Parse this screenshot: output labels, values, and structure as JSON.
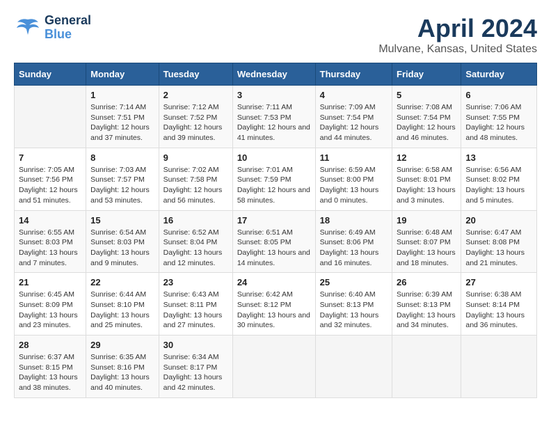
{
  "header": {
    "logo_general": "General",
    "logo_blue": "Blue",
    "month_title": "April 2024",
    "location": "Mulvane, Kansas, United States"
  },
  "calendar": {
    "weekdays": [
      "Sunday",
      "Monday",
      "Tuesday",
      "Wednesday",
      "Thursday",
      "Friday",
      "Saturday"
    ],
    "weeks": [
      [
        {
          "day": "",
          "sunrise": "",
          "sunset": "",
          "daylight": ""
        },
        {
          "day": "1",
          "sunrise": "Sunrise: 7:14 AM",
          "sunset": "Sunset: 7:51 PM",
          "daylight": "Daylight: 12 hours and 37 minutes."
        },
        {
          "day": "2",
          "sunrise": "Sunrise: 7:12 AM",
          "sunset": "Sunset: 7:52 PM",
          "daylight": "Daylight: 12 hours and 39 minutes."
        },
        {
          "day": "3",
          "sunrise": "Sunrise: 7:11 AM",
          "sunset": "Sunset: 7:53 PM",
          "daylight": "Daylight: 12 hours and 41 minutes."
        },
        {
          "day": "4",
          "sunrise": "Sunrise: 7:09 AM",
          "sunset": "Sunset: 7:54 PM",
          "daylight": "Daylight: 12 hours and 44 minutes."
        },
        {
          "day": "5",
          "sunrise": "Sunrise: 7:08 AM",
          "sunset": "Sunset: 7:54 PM",
          "daylight": "Daylight: 12 hours and 46 minutes."
        },
        {
          "day": "6",
          "sunrise": "Sunrise: 7:06 AM",
          "sunset": "Sunset: 7:55 PM",
          "daylight": "Daylight: 12 hours and 48 minutes."
        }
      ],
      [
        {
          "day": "7",
          "sunrise": "Sunrise: 7:05 AM",
          "sunset": "Sunset: 7:56 PM",
          "daylight": "Daylight: 12 hours and 51 minutes."
        },
        {
          "day": "8",
          "sunrise": "Sunrise: 7:03 AM",
          "sunset": "Sunset: 7:57 PM",
          "daylight": "Daylight: 12 hours and 53 minutes."
        },
        {
          "day": "9",
          "sunrise": "Sunrise: 7:02 AM",
          "sunset": "Sunset: 7:58 PM",
          "daylight": "Daylight: 12 hours and 56 minutes."
        },
        {
          "day": "10",
          "sunrise": "Sunrise: 7:01 AM",
          "sunset": "Sunset: 7:59 PM",
          "daylight": "Daylight: 12 hours and 58 minutes."
        },
        {
          "day": "11",
          "sunrise": "Sunrise: 6:59 AM",
          "sunset": "Sunset: 8:00 PM",
          "daylight": "Daylight: 13 hours and 0 minutes."
        },
        {
          "day": "12",
          "sunrise": "Sunrise: 6:58 AM",
          "sunset": "Sunset: 8:01 PM",
          "daylight": "Daylight: 13 hours and 3 minutes."
        },
        {
          "day": "13",
          "sunrise": "Sunrise: 6:56 AM",
          "sunset": "Sunset: 8:02 PM",
          "daylight": "Daylight: 13 hours and 5 minutes."
        }
      ],
      [
        {
          "day": "14",
          "sunrise": "Sunrise: 6:55 AM",
          "sunset": "Sunset: 8:03 PM",
          "daylight": "Daylight: 13 hours and 7 minutes."
        },
        {
          "day": "15",
          "sunrise": "Sunrise: 6:54 AM",
          "sunset": "Sunset: 8:03 PM",
          "daylight": "Daylight: 13 hours and 9 minutes."
        },
        {
          "day": "16",
          "sunrise": "Sunrise: 6:52 AM",
          "sunset": "Sunset: 8:04 PM",
          "daylight": "Daylight: 13 hours and 12 minutes."
        },
        {
          "day": "17",
          "sunrise": "Sunrise: 6:51 AM",
          "sunset": "Sunset: 8:05 PM",
          "daylight": "Daylight: 13 hours and 14 minutes."
        },
        {
          "day": "18",
          "sunrise": "Sunrise: 6:49 AM",
          "sunset": "Sunset: 8:06 PM",
          "daylight": "Daylight: 13 hours and 16 minutes."
        },
        {
          "day": "19",
          "sunrise": "Sunrise: 6:48 AM",
          "sunset": "Sunset: 8:07 PM",
          "daylight": "Daylight: 13 hours and 18 minutes."
        },
        {
          "day": "20",
          "sunrise": "Sunrise: 6:47 AM",
          "sunset": "Sunset: 8:08 PM",
          "daylight": "Daylight: 13 hours and 21 minutes."
        }
      ],
      [
        {
          "day": "21",
          "sunrise": "Sunrise: 6:45 AM",
          "sunset": "Sunset: 8:09 PM",
          "daylight": "Daylight: 13 hours and 23 minutes."
        },
        {
          "day": "22",
          "sunrise": "Sunrise: 6:44 AM",
          "sunset": "Sunset: 8:10 PM",
          "daylight": "Daylight: 13 hours and 25 minutes."
        },
        {
          "day": "23",
          "sunrise": "Sunrise: 6:43 AM",
          "sunset": "Sunset: 8:11 PM",
          "daylight": "Daylight: 13 hours and 27 minutes."
        },
        {
          "day": "24",
          "sunrise": "Sunrise: 6:42 AM",
          "sunset": "Sunset: 8:12 PM",
          "daylight": "Daylight: 13 hours and 30 minutes."
        },
        {
          "day": "25",
          "sunrise": "Sunrise: 6:40 AM",
          "sunset": "Sunset: 8:13 PM",
          "daylight": "Daylight: 13 hours and 32 minutes."
        },
        {
          "day": "26",
          "sunrise": "Sunrise: 6:39 AM",
          "sunset": "Sunset: 8:13 PM",
          "daylight": "Daylight: 13 hours and 34 minutes."
        },
        {
          "day": "27",
          "sunrise": "Sunrise: 6:38 AM",
          "sunset": "Sunset: 8:14 PM",
          "daylight": "Daylight: 13 hours and 36 minutes."
        }
      ],
      [
        {
          "day": "28",
          "sunrise": "Sunrise: 6:37 AM",
          "sunset": "Sunset: 8:15 PM",
          "daylight": "Daylight: 13 hours and 38 minutes."
        },
        {
          "day": "29",
          "sunrise": "Sunrise: 6:35 AM",
          "sunset": "Sunset: 8:16 PM",
          "daylight": "Daylight: 13 hours and 40 minutes."
        },
        {
          "day": "30",
          "sunrise": "Sunrise: 6:34 AM",
          "sunset": "Sunset: 8:17 PM",
          "daylight": "Daylight: 13 hours and 42 minutes."
        },
        {
          "day": "",
          "sunrise": "",
          "sunset": "",
          "daylight": ""
        },
        {
          "day": "",
          "sunrise": "",
          "sunset": "",
          "daylight": ""
        },
        {
          "day": "",
          "sunrise": "",
          "sunset": "",
          "daylight": ""
        },
        {
          "day": "",
          "sunrise": "",
          "sunset": "",
          "daylight": ""
        }
      ]
    ]
  }
}
